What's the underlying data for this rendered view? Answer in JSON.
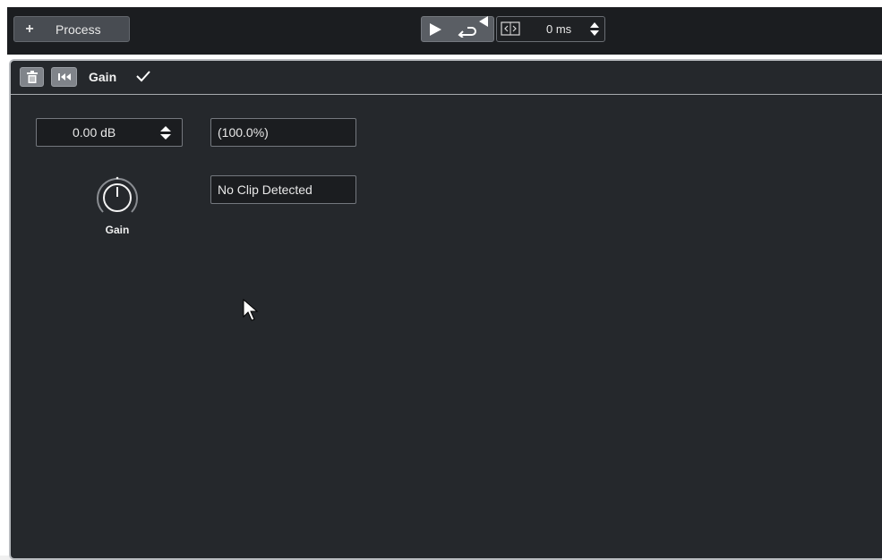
{
  "toolbar": {
    "add_symbol": "+",
    "process_label": "Process",
    "play_icon": "play-icon",
    "loop_icon": "loop-icon",
    "preroll_icon": "range-icon",
    "preroll_value": "0 ms"
  },
  "module": {
    "title": "Gain",
    "enabled_icon": "check-icon",
    "delete_icon": "trash-icon",
    "reset_icon": "skip-to-start-icon",
    "gain_value": "0.00 dB",
    "gain_percent": "(100.0%)",
    "clip_status": "No Clip Detected",
    "knob_label": "Gain"
  },
  "colors": {
    "toolbar_bg": "#1b1d20",
    "panel_bg": "#25282c",
    "field_bg": "#1b1d20",
    "accent_border": "#b9bcc0"
  }
}
